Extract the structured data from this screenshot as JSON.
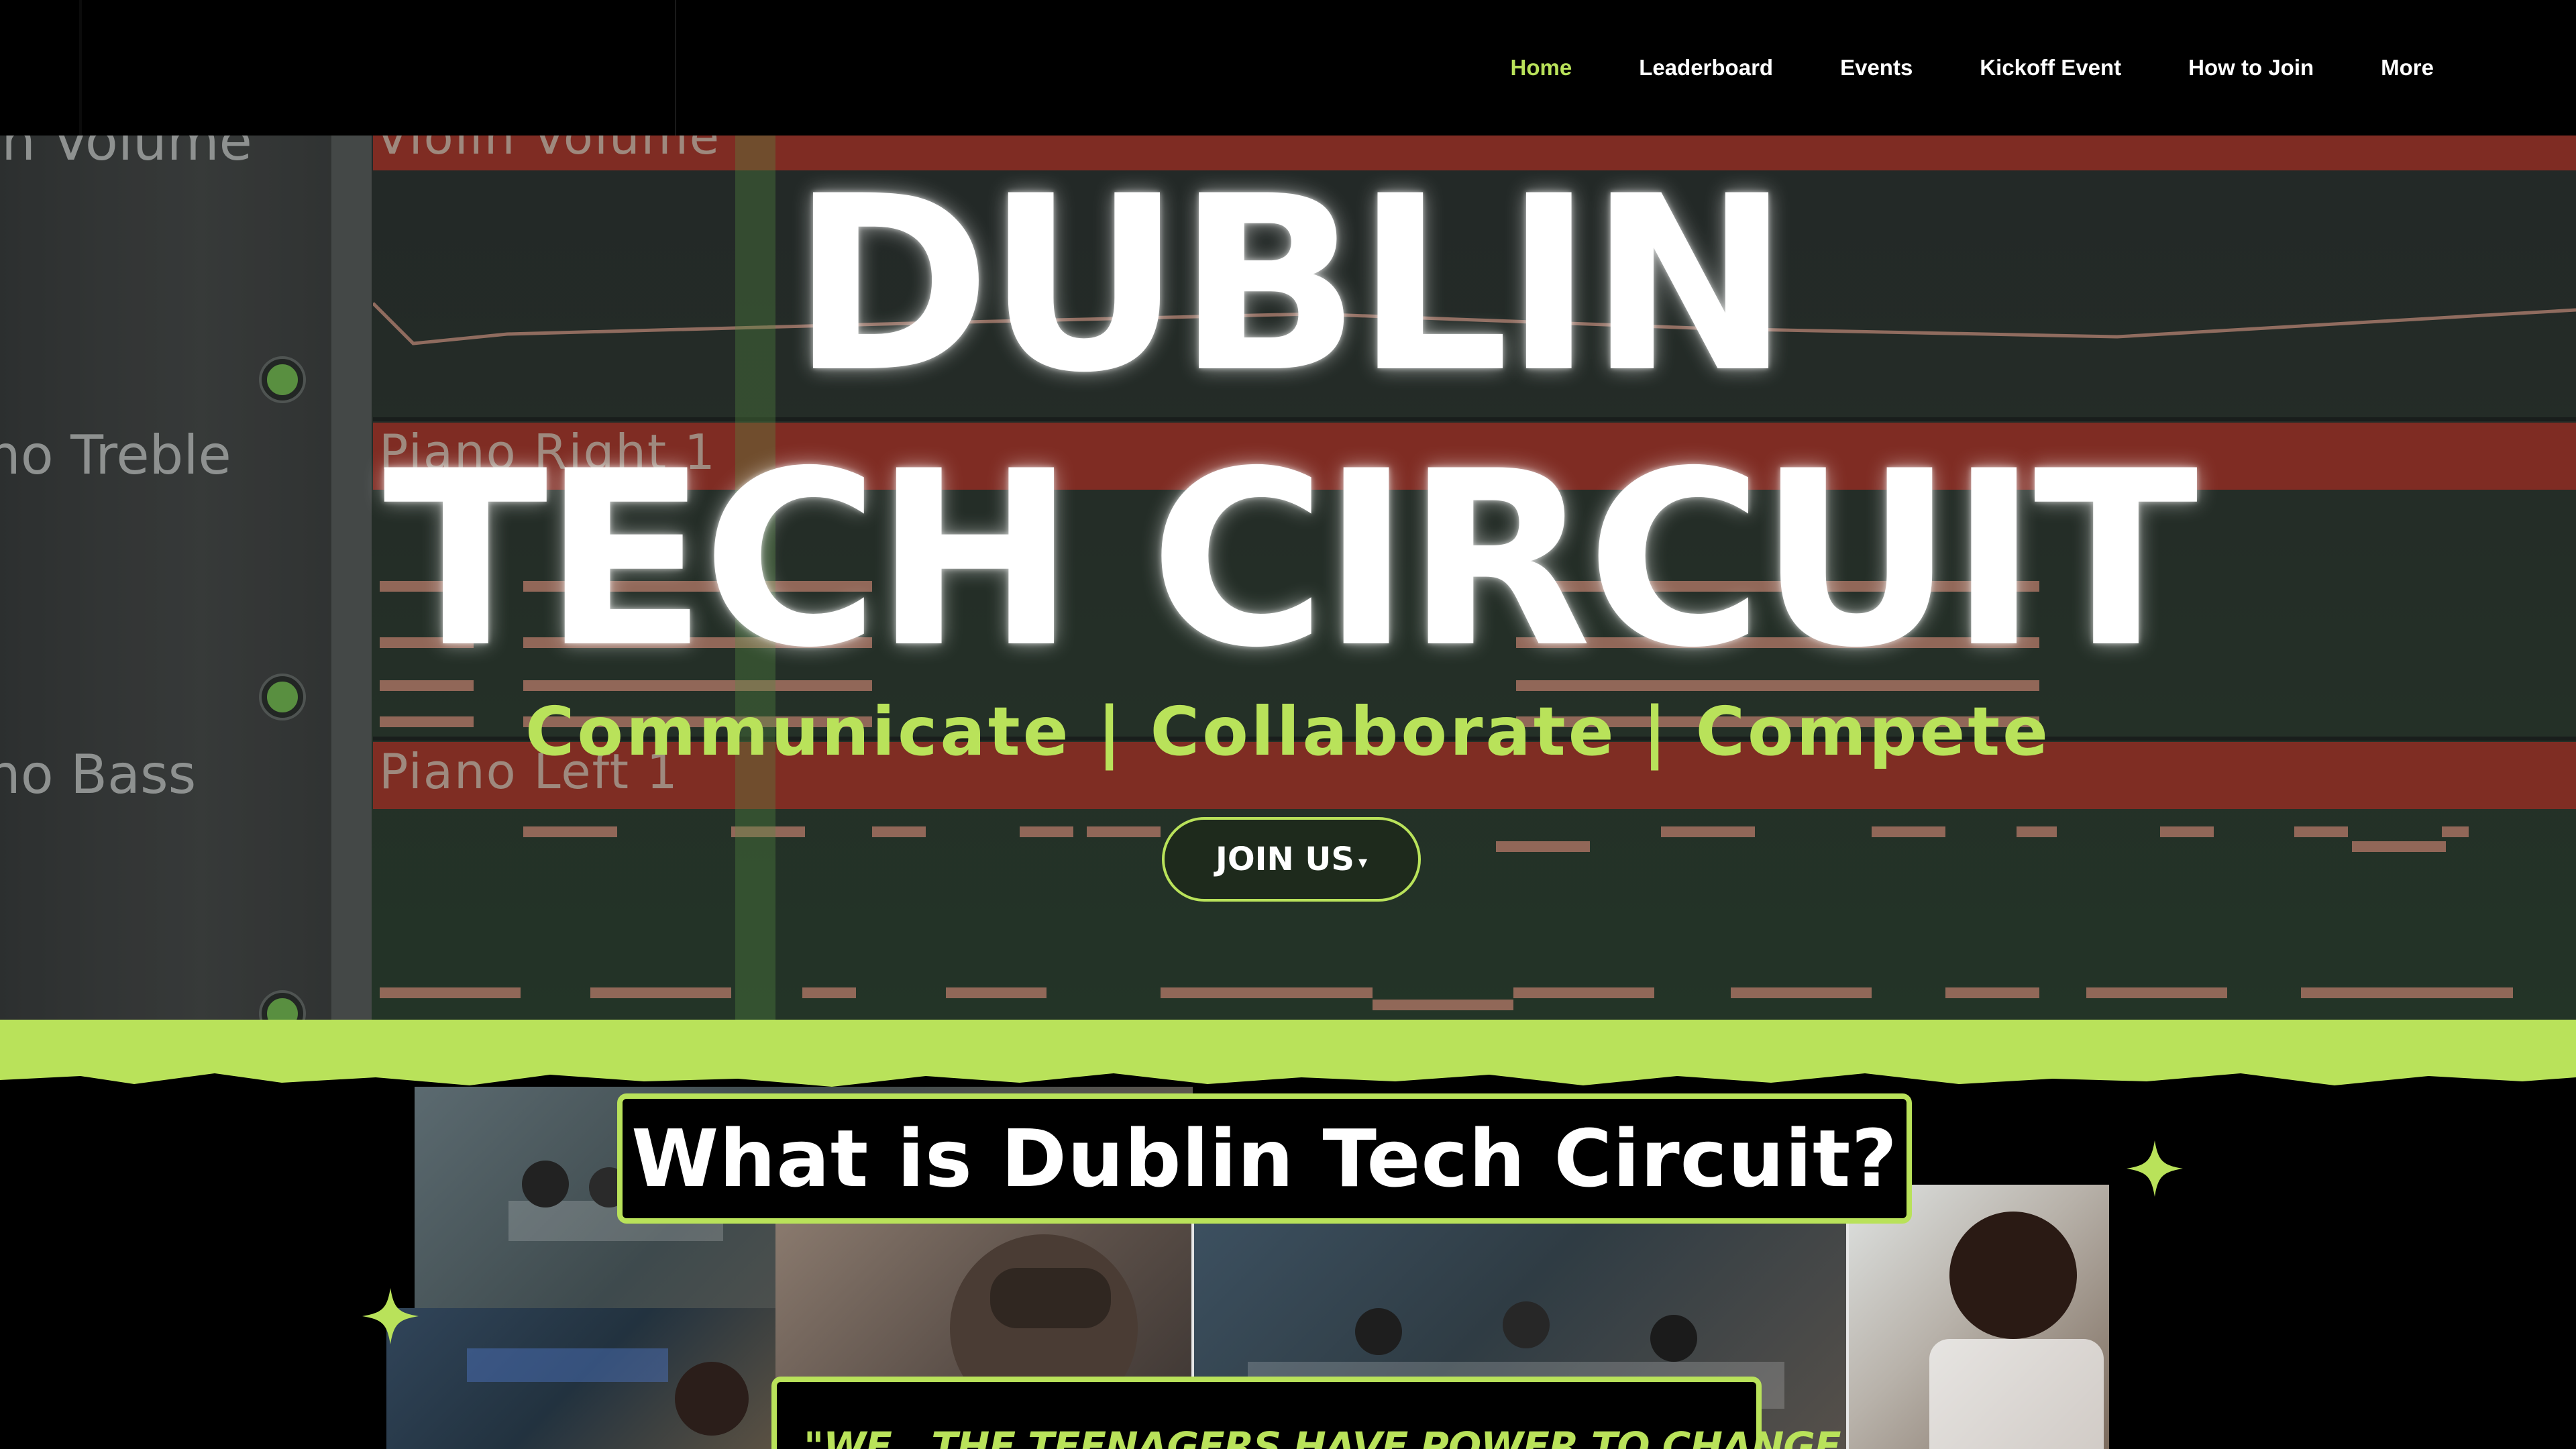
{
  "nav": {
    "items": [
      {
        "label": "Home",
        "active": true
      },
      {
        "label": "Leaderboard",
        "active": false
      },
      {
        "label": "Events",
        "active": false
      },
      {
        "label": "Kickoff Event",
        "active": false
      },
      {
        "label": "How to Join",
        "active": false
      },
      {
        "label": "More",
        "active": false
      }
    ]
  },
  "hero": {
    "title_line1": "DUBLIN",
    "title_line2": "TECH CIRCUIT",
    "tagline": "Communicate | Collaborate | Compete",
    "cta_label": "JOIN US",
    "background": {
      "top_band_label": "Violin Volume",
      "band1_label": "Piano Right 1",
      "band2_label": "Piano Left 1",
      "side_label_1": "ln Volume",
      "side_label_2": "no Treble",
      "side_label_3": "no Bass"
    }
  },
  "about": {
    "title": "What is Dublin Tech Circuit?",
    "quote": "\"WE , THE TEENAGERS HAVE POWER TO CHANGE"
  },
  "colors": {
    "accent": "#b9e25a",
    "background": "#000000",
    "text": "#ffffff"
  }
}
